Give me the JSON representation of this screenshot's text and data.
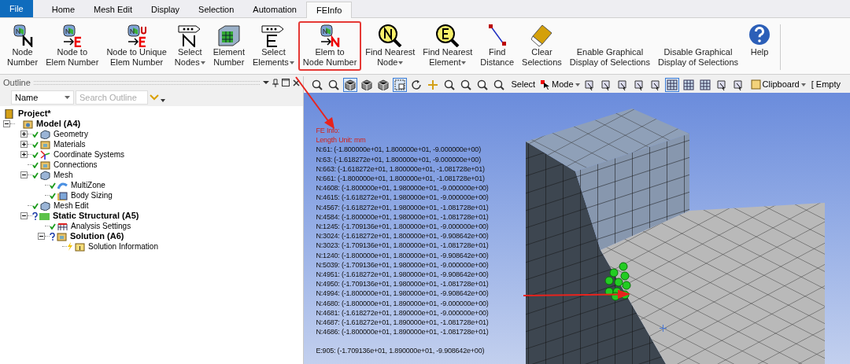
{
  "tabs": [
    {
      "label": "File",
      "kind": "file",
      "selected": false
    },
    {
      "label": "Home",
      "kind": "tab",
      "selected": false
    },
    {
      "label": "Mesh Edit",
      "kind": "tab",
      "selected": false
    },
    {
      "label": "Display",
      "kind": "tab",
      "selected": false
    },
    {
      "label": "Selection",
      "kind": "tab",
      "selected": false
    },
    {
      "label": "Automation",
      "kind": "tab",
      "selected": false
    },
    {
      "label": "FEInfo",
      "kind": "tab",
      "selected": true
    }
  ],
  "ribbon": [
    {
      "lines": [
        "Node",
        "Number"
      ],
      "dropdown": false,
      "highlighted": false
    },
    {
      "lines": [
        "Node to",
        "Elem Number"
      ],
      "dropdown": false,
      "highlighted": false
    },
    {
      "lines": [
        "Node to Unique",
        "Elem Number"
      ],
      "dropdown": false,
      "highlighted": false
    },
    {
      "lines": [
        "Select",
        "Nodes"
      ],
      "dropdown": true,
      "highlighted": false
    },
    {
      "lines": [
        "Element",
        "Number"
      ],
      "dropdown": false,
      "highlighted": false
    },
    {
      "lines": [
        "Select",
        "Elements"
      ],
      "dropdown": true,
      "highlighted": false
    },
    {
      "lines": [
        "Elem to",
        "Node Number"
      ],
      "dropdown": false,
      "highlighted": true
    },
    {
      "lines": [
        "Find Nearest",
        "Node"
      ],
      "dropdown": true,
      "highlighted": false
    },
    {
      "lines": [
        "Find Nearest",
        "Element"
      ],
      "dropdown": true,
      "highlighted": false
    },
    {
      "lines": [
        "Find",
        "Distance"
      ],
      "dropdown": false,
      "highlighted": false
    },
    {
      "lines": [
        "Clear",
        "Selections"
      ],
      "dropdown": false,
      "highlighted": false
    },
    {
      "lines": [
        "Enable Graphical",
        "Display of Selections"
      ],
      "dropdown": false,
      "highlighted": false
    },
    {
      "lines": [
        "Disable Graphical",
        "Display of Selections"
      ],
      "dropdown": false,
      "highlighted": false
    },
    {
      "lines": [
        "Help"
      ],
      "dropdown": false,
      "highlighted": false
    }
  ],
  "outline": {
    "title": "Outline",
    "filter": {
      "value": "Name"
    },
    "search": {
      "placeholder": "Search Outline"
    },
    "tree": [
      {
        "label": "Project*",
        "bold": true,
        "children": [
          {
            "label": "Model (A4)",
            "bold": true,
            "expanded": true,
            "children": [
              {
                "label": "Geometry",
                "kind": "check",
                "bold": false,
                "expanded": false
              },
              {
                "label": "Materials",
                "kind": "check",
                "bold": false,
                "expanded": false
              },
              {
                "label": "Coordinate Systems",
                "kind": "check",
                "bold": false,
                "expanded": false
              },
              {
                "label": "Connections",
                "kind": "check",
                "bold": false
              },
              {
                "label": "Mesh",
                "kind": "check",
                "bold": false,
                "expanded": true,
                "children": [
                  {
                    "label": "MultiZone",
                    "kind": "check",
                    "bold": false
                  },
                  {
                    "label": "Body Sizing",
                    "kind": "check",
                    "bold": false
                  }
                ]
              },
              {
                "label": "Mesh Edit",
                "kind": "check",
                "bold": false
              },
              {
                "label": "Static Structural (A5)",
                "kind": "question",
                "bold": true,
                "expanded": true,
                "children": [
                  {
                    "label": "Analysis Settings",
                    "kind": "check",
                    "bold": false
                  },
                  {
                    "label": "Solution (A6)",
                    "kind": "question",
                    "bold": true,
                    "expanded": true,
                    "children": [
                      {
                        "label": "Solution Information",
                        "kind": "lightning",
                        "bold": false
                      }
                    ]
                  }
                ]
              }
            ]
          }
        ]
      }
    ]
  },
  "toolbar": [
    {
      "kind": "icon",
      "pressed": false
    },
    {
      "kind": "icon",
      "pressed": false
    },
    {
      "kind": "icon",
      "pressed": true
    },
    {
      "kind": "icon",
      "pressed": false
    },
    {
      "kind": "icon",
      "pressed": false
    },
    {
      "kind": "icon",
      "pressed": true
    },
    {
      "kind": "icon",
      "pressed": false
    },
    {
      "kind": "icon",
      "pressed": false
    },
    {
      "kind": "icon",
      "pressed": false
    },
    {
      "kind": "icon",
      "pressed": false
    },
    {
      "kind": "icon",
      "pressed": false
    },
    {
      "kind": "icon",
      "pressed": false
    },
    {
      "kind": "text",
      "label": "Select"
    },
    {
      "kind": "mode",
      "label": "Mode"
    },
    {
      "kind": "icon",
      "pressed": false
    },
    {
      "kind": "icon",
      "pressed": false
    },
    {
      "kind": "icon",
      "pressed": false
    },
    {
      "kind": "icon",
      "pressed": false
    },
    {
      "kind": "icon",
      "pressed": false
    },
    {
      "kind": "icon",
      "pressed": true
    },
    {
      "kind": "icon",
      "pressed": false
    },
    {
      "kind": "icon",
      "pressed": false
    },
    {
      "kind": "icon",
      "pressed": false
    },
    {
      "kind": "icon",
      "pressed": false
    },
    {
      "kind": "clipboard",
      "label": "Clipboard"
    },
    {
      "kind": "text",
      "label": "[ Empty"
    }
  ],
  "fe_info": {
    "header": [
      "FE Info:",
      "Length Unit: mm"
    ],
    "lines": [
      "N:61: (-1.800000e+01, 1.800000e+01, -9.000000e+00)",
      "N:63: (-1.618272e+01, 1.800000e+01, -9.000000e+00)",
      "N:663: (-1.618272e+01, 1.800000e+01, -1.081728e+01)",
      "N:661: (-1.800000e+01, 1.800000e+01, -1.081728e+01)",
      "N:4608: (-1.800000e+01, 1.980000e+01, -9.000000e+00)",
      "N:4615: (-1.618272e+01, 1.980000e+01, -9.000000e+00)",
      "N:4567: (-1.618272e+01, 1.980000e+01, -1.081728e+01)",
      "N:4584: (-1.800000e+01, 1.980000e+01, -1.081728e+01)",
      "N:1245: (-1.709136e+01, 1.800000e+01, -9.000000e+00)",
      "N:3024: (-1.618272e+01, 1.800000e+01, -9.908642e+00)",
      "N:3023: (-1.709136e+01, 1.800000e+01, -1.081728e+01)",
      "N:1240: (-1.800000e+01, 1.800000e+01, -9.908642e+00)",
      "N:5039: (-1.709136e+01, 1.980000e+01, -9.000000e+00)",
      "N:4951: (-1.618272e+01, 1.980000e+01, -9.908642e+00)",
      "N:4950: (-1.709136e+01, 1.980000e+01, -1.081728e+01)",
      "N:4994: (-1.800000e+01, 1.980000e+01, -9.908642e+00)",
      "N:4680: (-1.800000e+01, 1.890000e+01, -9.000000e+00)",
      "N:4681: (-1.618272e+01, 1.890000e+01, -9.000000e+00)",
      "N:4687: (-1.618272e+01, 1.890000e+01, -1.081728e+01)",
      "N:4686: (-1.800000e+01, 1.890000e+01, -1.081728e+01)"
    ],
    "element": "E:905: (-1.709136e+01, 1.890000e+01, -9.908642e+00)"
  }
}
